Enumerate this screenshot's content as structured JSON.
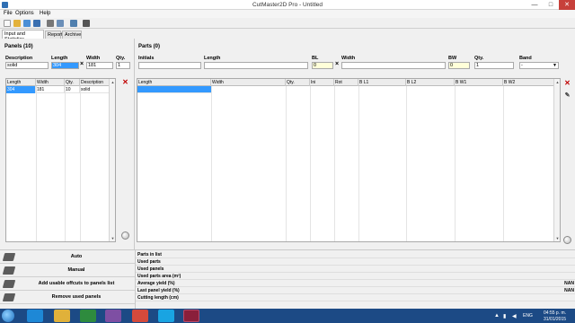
{
  "window": {
    "title": "CutMaster2D Pro - Untitled",
    "min": "—",
    "max": "□",
    "close": "✕"
  },
  "menu": [
    "File",
    "Options",
    "Help"
  ],
  "toolbar_icons": [
    "new-icon",
    "open-icon",
    "save-icon",
    "save-as-icon",
    "print-icon",
    "info-icon",
    "import-icon",
    "export-icon"
  ],
  "tabs": [
    "Input and Statistics",
    "Report",
    "Archive"
  ],
  "panels": {
    "title": "Panels (10)",
    "form_labels": {
      "description": "Description",
      "length": "Length",
      "width": "Width",
      "qty": "Qty."
    },
    "form_values": {
      "description": "solid",
      "length": "304",
      "width": "181",
      "qty": "1"
    },
    "columns": [
      "Length",
      "Width",
      "Qty.",
      "Description"
    ],
    "rows": [
      {
        "length": "304",
        "width": "181",
        "qty": "10",
        "description": "solid"
      }
    ]
  },
  "parts": {
    "title": "Parts (0)",
    "form_labels": {
      "initials": "Initials",
      "length": "Length",
      "bl": "BL",
      "width": "Width",
      "bw": "BW",
      "qty": "Qty.",
      "band": "Band"
    },
    "form_values": {
      "initials": "",
      "length": "",
      "bl": "0",
      "width": "",
      "bw": "0",
      "qty": "1",
      "band": "-"
    },
    "columns": [
      "Length",
      "Width",
      "Qty.",
      "Ini",
      "Rot",
      "B L1",
      "B L2",
      "B W1",
      "B W2"
    ]
  },
  "actions": [
    "Auto",
    "Manual",
    "Add usable offcuts to panels list",
    "Remove used panels"
  ],
  "stats": [
    {
      "label": "Parts in list",
      "value": ""
    },
    {
      "label": "Used parts",
      "value": ""
    },
    {
      "label": "Used panels",
      "value": ""
    },
    {
      "label": "Used parts area (m²)",
      "value": ""
    },
    {
      "label": "Average yield (%)",
      "value": "NAN"
    },
    {
      "label": "Last panel yield (%)",
      "value": "NAN"
    },
    {
      "label": "Cutting length (cm)",
      "value": ""
    }
  ],
  "taskbar": {
    "lang": "ENG",
    "time": "04:55 p. m.",
    "date": "31/01/2015"
  },
  "colors": {
    "taskbar": "#1c4a85",
    "selection": "#3399ff",
    "close": "#c7403a"
  }
}
